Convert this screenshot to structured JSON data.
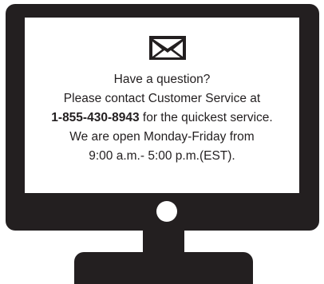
{
  "icon": "mail-envelope-icon",
  "message": {
    "line1": "Have a question?",
    "line2": "Please contact Customer Service at",
    "phone": "1-855-430-8943",
    "line3_suffix": " for the quickest service.",
    "line4": "We are open Monday-Friday from",
    "line5": "9:00 a.m.- 5:00 p.m.(EST)."
  },
  "colors": {
    "monitor": "#231f20",
    "screen": "#ffffff",
    "text": "#231f20"
  }
}
